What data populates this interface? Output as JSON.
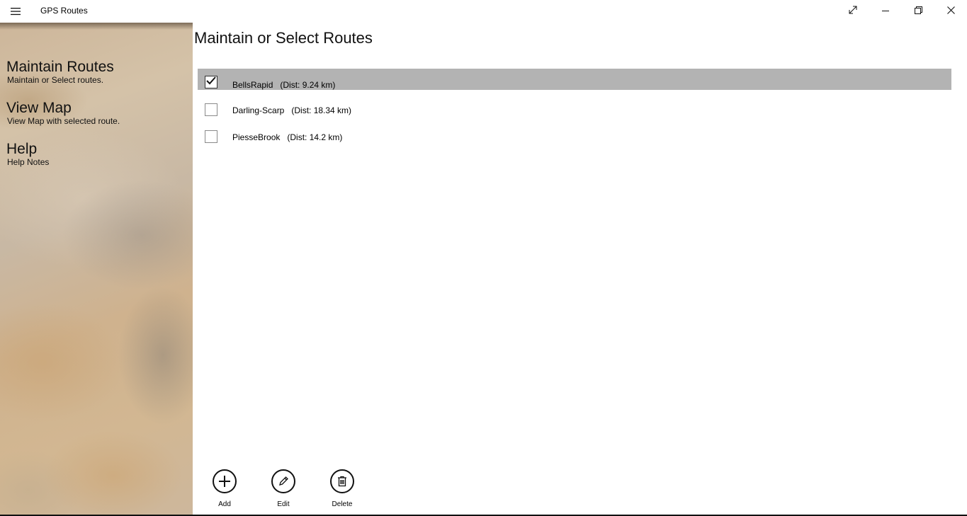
{
  "window": {
    "title": "GPS Routes",
    "icons": {
      "menu": "hamburger-icon",
      "fullscreen": "expand-diagonal-icon",
      "minimize": "minimize-icon",
      "restore": "restore-icon",
      "close": "close-icon"
    }
  },
  "sidebar": {
    "items": [
      {
        "title": "Maintain Routes",
        "subtitle": "Maintain or Select routes."
      },
      {
        "title": "View Map",
        "subtitle": "View Map with selected route."
      },
      {
        "title": "Help",
        "subtitle": "Help Notes"
      }
    ]
  },
  "main": {
    "title": "Maintain or Select Routes",
    "routes": [
      {
        "text": "BellsRapid   (Dist: 9.24 km)",
        "checked": true
      },
      {
        "text": "Darling-Scarp   (Dist: 18.34 km)",
        "checked": false
      },
      {
        "text": "PiesseBrook   (Dist: 14.2 km)",
        "checked": false
      }
    ],
    "selected_row_color": "#b3b3b3"
  },
  "commands": {
    "add_label": "Add",
    "edit_label": "Edit",
    "delete_label": "Delete"
  }
}
